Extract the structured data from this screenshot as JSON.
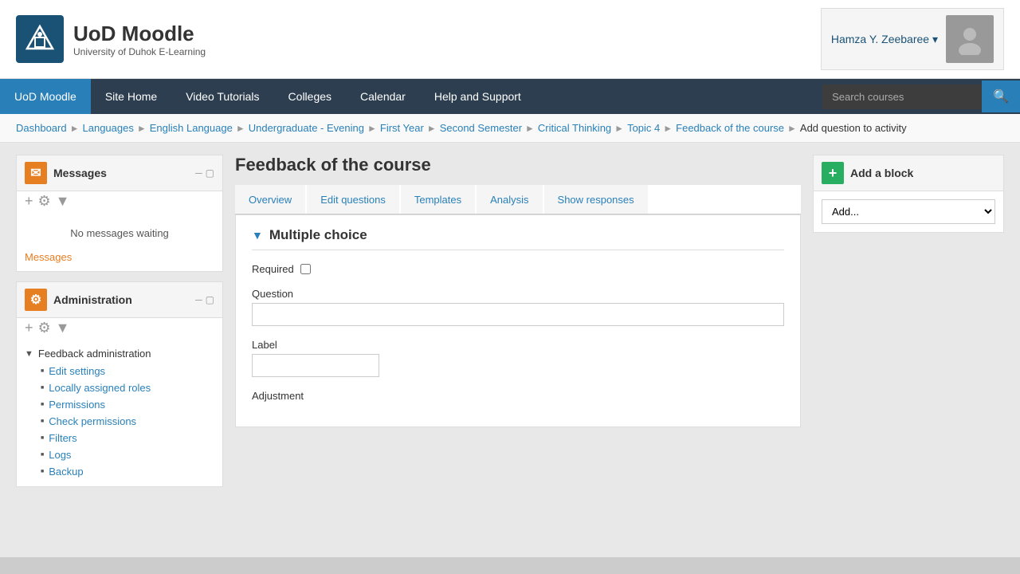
{
  "header": {
    "logo_text": "UoD Moodle",
    "logo_subtitle": "University of Duhok E-Learning",
    "user_name": "Hamza Y. Zeebaree"
  },
  "navbar": {
    "items": [
      {
        "label": "UoD Moodle",
        "active": true
      },
      {
        "label": "Site Home",
        "active": false
      },
      {
        "label": "Video Tutorials",
        "active": false
      },
      {
        "label": "Colleges",
        "active": false
      },
      {
        "label": "Calendar",
        "active": false
      },
      {
        "label": "Help and Support",
        "active": false
      }
    ],
    "search_placeholder": "Search courses"
  },
  "breadcrumb": {
    "items": [
      {
        "label": "Dashboard",
        "link": true
      },
      {
        "label": "Languages",
        "link": true
      },
      {
        "label": "English Language",
        "link": true
      },
      {
        "label": "Undergraduate - Evening",
        "link": true
      },
      {
        "label": "First Year",
        "link": true
      },
      {
        "label": "Second Semester",
        "link": true
      },
      {
        "label": "Critical Thinking",
        "link": true
      },
      {
        "label": "Topic 4",
        "link": true
      },
      {
        "label": "Feedback of the course",
        "link": true
      },
      {
        "label": "Add question to activity",
        "link": false
      }
    ]
  },
  "sidebar": {
    "messages_block": {
      "title": "Messages",
      "no_messages": "No messages waiting",
      "messages_link": "Messages",
      "controls": [
        "─",
        "□"
      ]
    },
    "admin_block": {
      "title": "Administration",
      "controls": [
        "─",
        "□"
      ],
      "feedback_admin_label": "Feedback administration",
      "items": [
        {
          "label": "Edit settings"
        },
        {
          "label": "Locally assigned roles"
        },
        {
          "label": "Permissions"
        },
        {
          "label": "Check permissions"
        },
        {
          "label": "Filters"
        },
        {
          "label": "Logs"
        },
        {
          "label": "Backup"
        }
      ]
    }
  },
  "content": {
    "title": "Feedback of the course",
    "tabs": [
      {
        "label": "Overview",
        "active": false
      },
      {
        "label": "Edit questions",
        "active": false
      },
      {
        "label": "Templates",
        "active": false
      },
      {
        "label": "Analysis",
        "active": false
      },
      {
        "label": "Show responses",
        "active": false
      }
    ],
    "section_title": "Multiple choice",
    "required_label": "Required",
    "question_label": "Question",
    "question_placeholder": "",
    "label_label": "Label",
    "label_placeholder": "",
    "adjustment_label": "Adjustment"
  },
  "add_block": {
    "title": "Add a block",
    "icon": "+",
    "select_default": "Add...",
    "options": [
      "Add..."
    ]
  }
}
